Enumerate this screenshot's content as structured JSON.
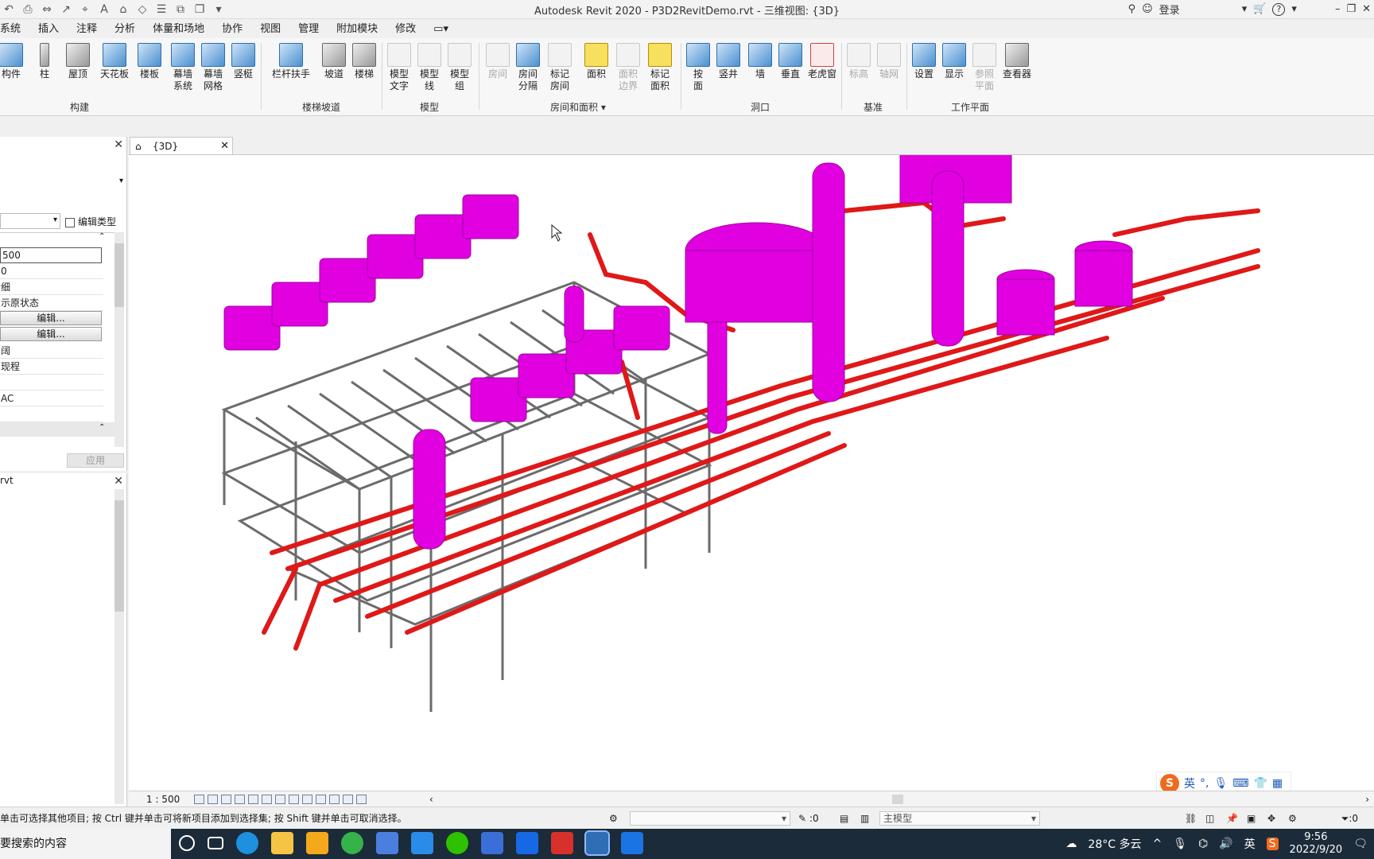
{
  "window": {
    "title": "Autodesk Revit 2020 - P3D2RevitDemo.rvt - 三维视图: {3D}",
    "login_label": "登录",
    "help_label": "?"
  },
  "ribbon_tabs": [
    "系统",
    "插入",
    "注释",
    "分析",
    "体量和场地",
    "协作",
    "视图",
    "管理",
    "附加模块",
    "修改"
  ],
  "ribbon": {
    "build": {
      "group": "构建",
      "buttons": [
        "构件",
        "柱",
        "屋顶",
        "天花板",
        "楼板",
        "幕墙\n系统",
        "幕墙\n网格",
        "竖梃"
      ]
    },
    "stairs": {
      "group": "楼梯坡道",
      "buttons": [
        "栏杆扶手",
        "坡道",
        "楼梯"
      ]
    },
    "model": {
      "group": "模型",
      "buttons": [
        "模型\n文字",
        "模型\n线",
        "模型\n组"
      ]
    },
    "room": {
      "group": "房间和面积",
      "buttons": [
        "房间",
        "房间\n分隔",
        "标记\n房间",
        "面积",
        "面积\n边界",
        "标记\n面积"
      ]
    },
    "opening": {
      "group": "洞口",
      "buttons": [
        "按\n面",
        "竖井",
        "墙",
        "垂直",
        "老虎窗"
      ]
    },
    "datum": {
      "group": "基准",
      "buttons": [
        "标高",
        "轴网"
      ]
    },
    "workplane": {
      "group": "工作平面",
      "buttons": [
        "设置",
        "显示",
        "参照\n平面",
        "查看器"
      ]
    }
  },
  "properties": {
    "edit_type_label": "编辑类型",
    "scale_value": "500",
    "row_b": "0",
    "row_c": "细",
    "row_d": "示原状态",
    "edit_btn_1": "编辑...",
    "edit_btn_2": "编辑...",
    "row_e": "阔",
    "row_f": "现程",
    "row_g": "AC",
    "apply_label": "应用"
  },
  "project_browser": {
    "title": "rvt"
  },
  "view_tab": {
    "label": "{3D}"
  },
  "view_control": {
    "scale": "1 : 500"
  },
  "ime": {
    "logo": "S",
    "lang": "英"
  },
  "status": {
    "message": "单击可选择其他项目; 按 Ctrl 键并单击可将新项目添加到选择集; 按 Shift 键并单击可取消选择。",
    "selected_count": ":0",
    "model_combo": "主模型",
    "filter_count": ":0"
  },
  "taskbar": {
    "search_text": "要搜索的内容",
    "weather": "28°C 多云",
    "ime_lang": "英",
    "time": "9:56",
    "date": "2022/9/20"
  }
}
